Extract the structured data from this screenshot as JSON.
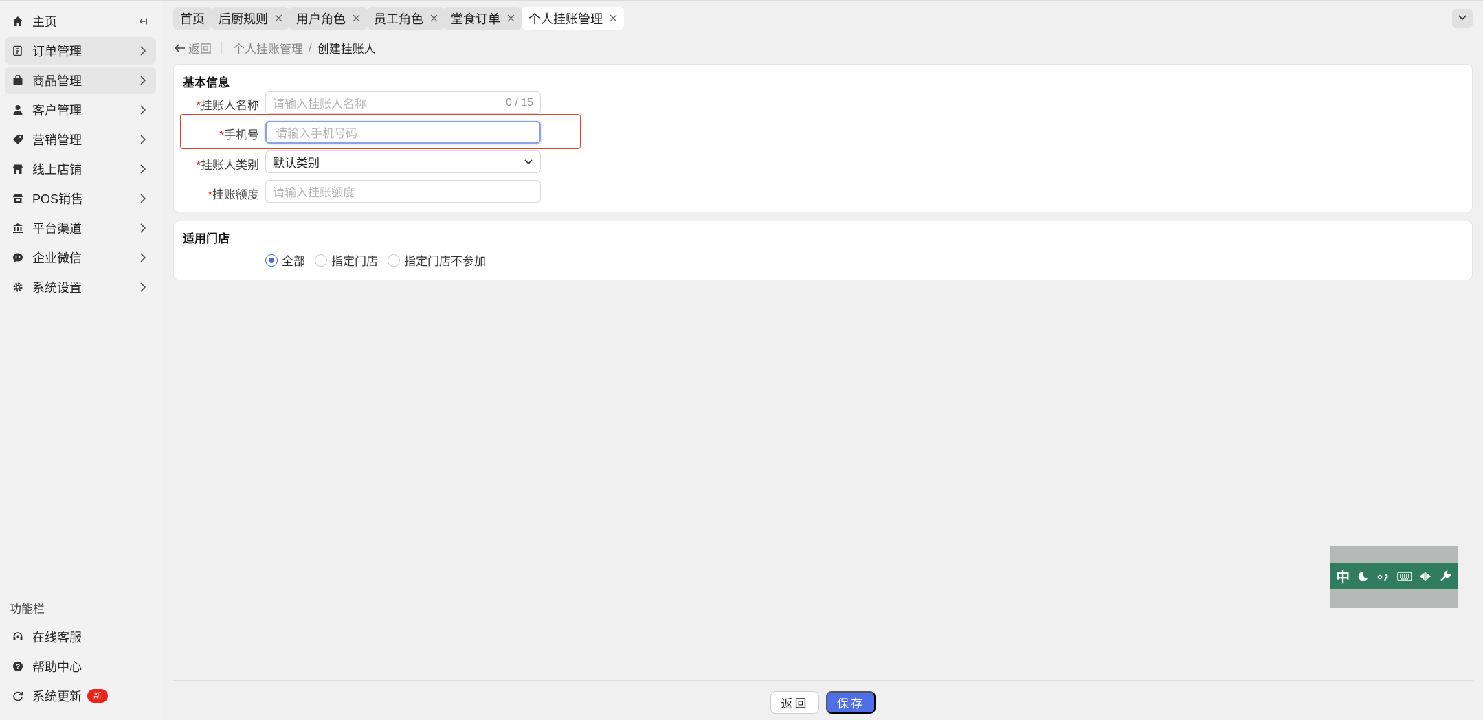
{
  "sidebar": {
    "items": [
      {
        "label": "主页",
        "icon": "home-icon",
        "trailing": "collapse-icon"
      },
      {
        "label": "订单管理",
        "icon": "order-icon",
        "trailing": "chevron-right-icon"
      },
      {
        "label": "商品管理",
        "icon": "product-icon",
        "trailing": "chevron-right-icon"
      },
      {
        "label": "客户管理",
        "icon": "user-icon",
        "trailing": "chevron-right-icon"
      },
      {
        "label": "营销管理",
        "icon": "tag-icon",
        "trailing": "chevron-right-icon"
      },
      {
        "label": "线上店铺",
        "icon": "store-icon",
        "trailing": "chevron-right-icon"
      },
      {
        "label": "POS销售",
        "icon": "pos-store-icon",
        "trailing": "chevron-right-icon"
      },
      {
        "label": "平台渠道",
        "icon": "bank-icon",
        "trailing": "chevron-right-icon"
      },
      {
        "label": "企业微信",
        "icon": "wechat-icon",
        "trailing": "chevron-right-icon"
      },
      {
        "label": "系统设置",
        "icon": "gear-icon",
        "trailing": "chevron-right-icon"
      }
    ],
    "func_title": "功能栏",
    "func_items": [
      {
        "label": "在线客服",
        "icon": "headset-icon"
      },
      {
        "label": "帮助中心",
        "icon": "help-icon"
      },
      {
        "label": "系统更新",
        "icon": "refresh-icon",
        "badge": "新"
      }
    ]
  },
  "tabs": [
    {
      "label": "首页",
      "closable": false
    },
    {
      "label": "后厨规则",
      "closable": true
    },
    {
      "label": "用户角色",
      "closable": true
    },
    {
      "label": "员工角色",
      "closable": true
    },
    {
      "label": "堂食订单",
      "closable": true
    },
    {
      "label": "个人挂账管理",
      "closable": true,
      "active": true
    }
  ],
  "breadcrumb": {
    "back": "返回",
    "parent": "个人挂账管理",
    "separator": "/",
    "current": "创建挂账人"
  },
  "basic_info": {
    "title": "基本信息",
    "name": {
      "label": "挂账人名称",
      "placeholder": "请输入挂账人名称",
      "counter": "0 / 15"
    },
    "phone": {
      "label": "手机号",
      "placeholder": "请输入手机号码"
    },
    "category": {
      "label": "挂账人类别",
      "value": "默认类别"
    },
    "limit": {
      "label": "挂账额度",
      "placeholder": "请输入挂账额度"
    },
    "required_mark": "*"
  },
  "stores": {
    "title": "适用门店",
    "options": [
      {
        "label": "全部",
        "checked": true
      },
      {
        "label": "指定门店",
        "checked": false
      },
      {
        "label": "指定门店不参加",
        "checked": false
      }
    ]
  },
  "footer": {
    "back": "返回",
    "save": "保存"
  },
  "ime": {
    "mode": "中"
  },
  "colors": {
    "primary": "#4f6fe8",
    "required": "#e8251b",
    "ime_green": "#2f7c60"
  }
}
